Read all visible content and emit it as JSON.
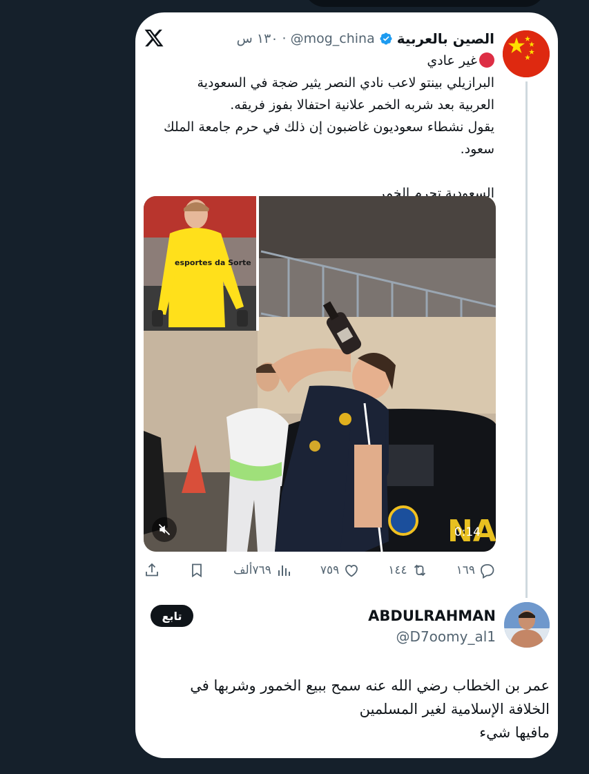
{
  "tweet": {
    "display_name": "الصين بالعربية",
    "handle": "@mog_china",
    "time": "١٣٠ س",
    "lines": [
      "غير عادي",
      "البرازيلي بينتو لاعب نادي النصر يثير ضجة في السعودية",
      "العربية بعد شربه الخمر علانية احتفالا بفوز فريقه.",
      "يقول نشطاء سعوديون غاضبون إن ذلك في حرم جامعة الملك",
      "سعود.",
      "السعودية تجرم الخمر"
    ],
    "media": {
      "duration": "0:14",
      "jersey_sponsor": "esportes da Sorte",
      "car_text": "NAS"
    },
    "stats": {
      "replies": "١٦٩",
      "reposts": "١٤٤",
      "likes": "٧٥٩",
      "views": "٧٦٩ألف"
    }
  },
  "reply": {
    "display_name": "ABDULRAHMAN",
    "handle": "@D7oomy_al1",
    "follow_label": "تابع",
    "lines": [
      "عمر بن الخطاب رضي الله عنه سمح ببيع الخمور وشربها في",
      "الخلافة الإسلامية لغير المسلمين",
      "مافيها شيء"
    ]
  },
  "colors": {
    "background": "#15202b",
    "card": "#ffffff",
    "text_primary": "#0f1419",
    "text_secondary": "#536471",
    "verified": "#1d9bf0",
    "red_dot": "#dd2e44"
  },
  "icons": [
    "x-logo-icon",
    "verified-badge-icon",
    "red-circle-icon",
    "mute-icon",
    "reply-icon",
    "repost-icon",
    "like-icon",
    "views-icon",
    "bookmark-icon",
    "share-icon"
  ]
}
